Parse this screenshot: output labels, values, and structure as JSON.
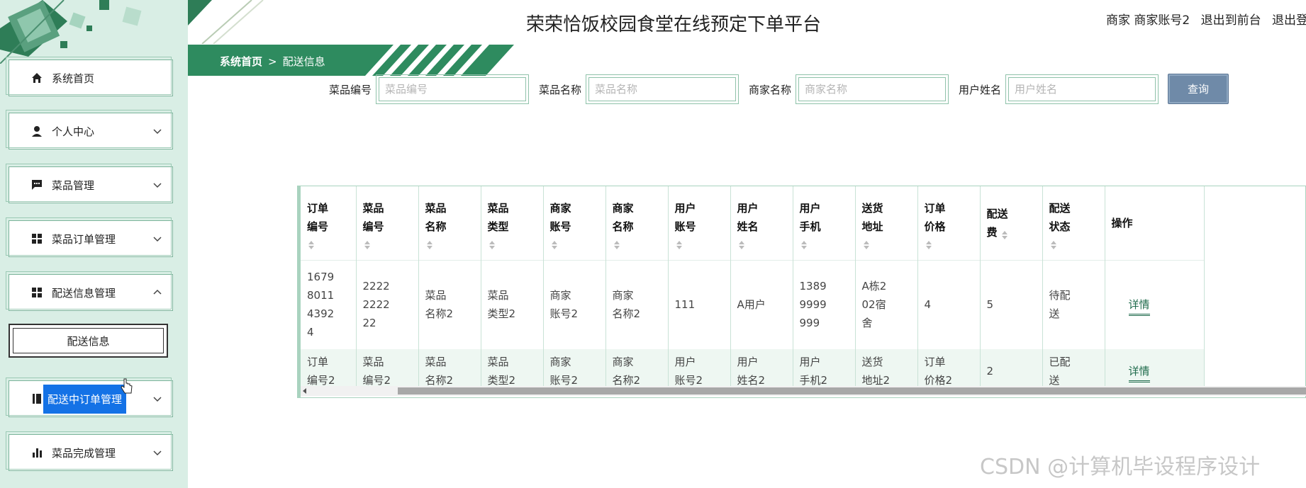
{
  "app": {
    "title": "荣荣恰饭校园食堂在线预定下单平台",
    "user_info": "商家 商家账号2",
    "back_front": "退出到前台",
    "logout": "退出登"
  },
  "breadcrumb": {
    "home": "系统首页",
    "separator": ">",
    "current": "配送信息"
  },
  "sidebar": {
    "items": [
      {
        "label": "系统首页",
        "icon": "home-icon"
      },
      {
        "label": "个人中心",
        "icon": "user-icon",
        "chevron": "chevron-down-icon"
      },
      {
        "label": "菜品管理",
        "icon": "chat-icon",
        "chevron": "chevron-down-icon"
      },
      {
        "label": "菜品订单管理",
        "icon": "grid-icon",
        "chevron": "chevron-down-icon"
      },
      {
        "label": "配送信息管理",
        "icon": "grid-icon",
        "chevron": "chevron-up-icon"
      },
      {
        "label": "配送信息"
      },
      {
        "label": "配送中订单管理",
        "icon": "book-icon",
        "chevron": "chevron-down-icon"
      },
      {
        "label": "菜品完成管理",
        "icon": "bar-chart-icon",
        "chevron": "chevron-down-icon"
      }
    ]
  },
  "search": {
    "fields": [
      {
        "label": "菜品编号",
        "placeholder": "菜品编号"
      },
      {
        "label": "菜品名称",
        "placeholder": "菜品名称"
      },
      {
        "label": "商家名称",
        "placeholder": "商家名称"
      },
      {
        "label": "用户姓名",
        "placeholder": "用户姓名"
      }
    ],
    "button": "查询"
  },
  "table": {
    "headers": [
      [
        "订单",
        "编号"
      ],
      [
        "菜品",
        "编号"
      ],
      [
        "菜品",
        "名称"
      ],
      [
        "菜品",
        "类型"
      ],
      [
        "商家",
        "账号"
      ],
      [
        "商家",
        "名称"
      ],
      [
        "用户",
        "账号"
      ],
      [
        "用户",
        "姓名"
      ],
      [
        "用户",
        "手机"
      ],
      [
        "送货",
        "地址"
      ],
      [
        "订单",
        "价格"
      ],
      [
        "配送",
        "费"
      ],
      [
        "配送",
        "状态"
      ],
      [
        "操作"
      ]
    ],
    "rows": [
      {
        "cells": [
          [
            "1679",
            "8011",
            "4392",
            "4"
          ],
          [
            "2222",
            "2222",
            "22"
          ],
          [
            "菜品",
            "名称2"
          ],
          [
            "菜品",
            "类型2"
          ],
          [
            "商家",
            "账号2"
          ],
          [
            "商家",
            "名称2"
          ],
          [
            "111"
          ],
          [
            "A用户"
          ],
          [
            "1389",
            "9999",
            "999"
          ],
          [
            "A栋2",
            "02宿",
            "舍"
          ],
          [
            "4"
          ],
          [
            "5"
          ],
          [
            "待配",
            "送"
          ]
        ],
        "action": "详情"
      },
      {
        "cells": [
          [
            "订单",
            "编号2"
          ],
          [
            "菜品",
            "编号2"
          ],
          [
            "菜品",
            "名称2"
          ],
          [
            "菜品",
            "类型2"
          ],
          [
            "商家",
            "账号2"
          ],
          [
            "商家",
            "名称2"
          ],
          [
            "用户",
            "账号2"
          ],
          [
            "用户",
            "姓名2"
          ],
          [
            "用户",
            "手机2"
          ],
          [
            "送货",
            "地址2"
          ],
          [
            "订单",
            "价格2"
          ],
          [
            "2"
          ],
          [
            "已配",
            "送"
          ]
        ],
        "action": "详情"
      }
    ]
  },
  "watermark": "CSDN @计算机毕设程序设计",
  "colors": {
    "sidebar_bg": "#d9eee5",
    "brand_green": "#2e8b5f",
    "query_button": "#6f8aa8",
    "selected_menu": "#1472e6"
  }
}
